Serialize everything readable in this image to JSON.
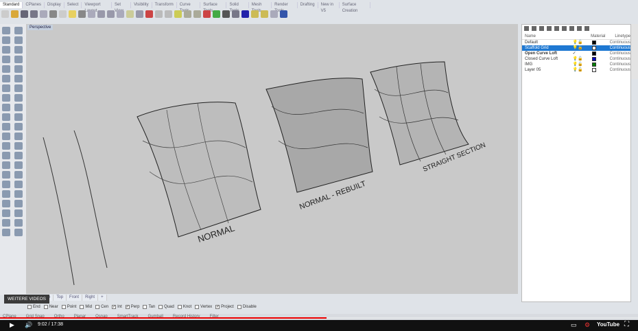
{
  "toolbar_tabs": [
    "Standard",
    "CPlanes",
    "Display",
    "Select",
    "Viewport Layout",
    "Set View",
    "Visibility",
    "Transform",
    "Curve Tools",
    "Surface Tools",
    "Solid Tools",
    "Mesh Tools",
    "Render Tools",
    "Drafting",
    "New in V5",
    "Surface Creation"
  ],
  "active_tab": "Standard",
  "viewport": {
    "label": "Perspective",
    "annotations": [
      "NORMAL",
      "NORMAL - REBUILT",
      "STRAIGHT SECTION"
    ]
  },
  "layers": {
    "headers": [
      "Name",
      "Material",
      "Linetype"
    ],
    "rows": [
      {
        "name": "Default",
        "color": "#000000",
        "linetype": "Continuous",
        "selected": false
      },
      {
        "name": "Scaffold Grid",
        "color": "#ffffff",
        "linetype": "Continuous",
        "selected": true
      },
      {
        "name": "Open Curve Loft",
        "color": "#000000",
        "linetype": "Continuous",
        "current": true
      },
      {
        "name": "Closed Curve Loft",
        "color": "#0000c0",
        "linetype": "Continuous"
      },
      {
        "name": "IMG",
        "color": "#008000",
        "linetype": "Continuous"
      },
      {
        "name": "Layer 05",
        "color": "#ffffff",
        "linetype": "Continuous"
      }
    ],
    "current_mark": "✓"
  },
  "viewport_tabs": [
    "Perspective",
    "Top",
    "Front",
    "Right",
    "+"
  ],
  "osnap": [
    {
      "label": "End",
      "on": false
    },
    {
      "label": "Near",
      "on": false
    },
    {
      "label": "Point",
      "on": false
    },
    {
      "label": "Mid",
      "on": false
    },
    {
      "label": "Cen",
      "on": false
    },
    {
      "label": "Int",
      "on": true
    },
    {
      "label": "Perp",
      "on": true
    },
    {
      "label": "Tan",
      "on": false
    },
    {
      "label": "Quad",
      "on": false
    },
    {
      "label": "Knot",
      "on": false
    },
    {
      "label": "Vertex",
      "on": false
    },
    {
      "label": "Project",
      "on": true
    },
    {
      "label": "Disable",
      "on": false
    }
  ],
  "status": [
    "CPlane",
    "Grid Snap",
    "Ortho",
    "Planar",
    "Osnap",
    "SmartTrack",
    "Gumball",
    "Record History",
    "Filter"
  ],
  "video": {
    "overlay": "WEITERE VIDEOS",
    "time": "9:02 / 17:38",
    "progress": 0.512,
    "logo": "YouTube"
  }
}
